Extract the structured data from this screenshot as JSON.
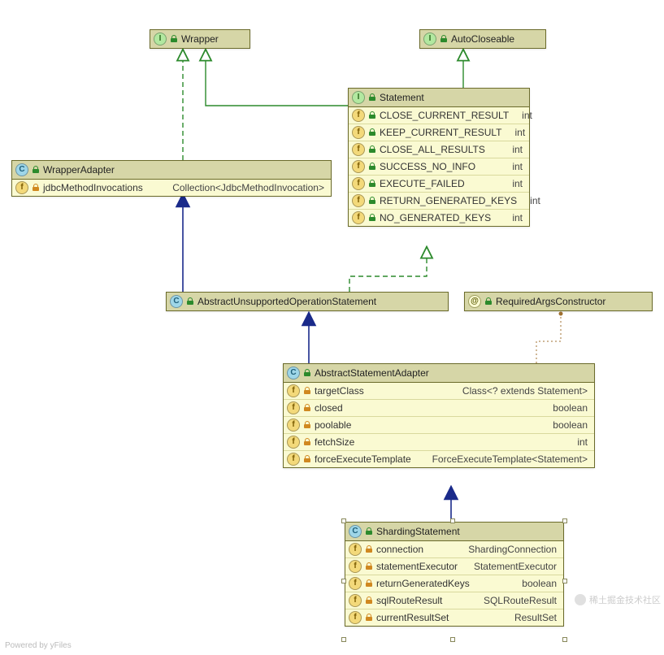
{
  "nodes": {
    "wrapper": {
      "kind": "I",
      "title": "Wrapper"
    },
    "autoCloseable": {
      "kind": "I",
      "title": "AutoCloseable"
    },
    "wrapperAdapter": {
      "kind": "C",
      "title": "WrapperAdapter",
      "rows": [
        {
          "icon": "f",
          "lock": "orange",
          "name": "jdbcMethodInvocations",
          "type": "Collection<JdbcMethodInvocation>"
        }
      ]
    },
    "statement": {
      "kind": "I",
      "title": "Statement",
      "rows": [
        {
          "icon": "f",
          "lock": "green",
          "name": "CLOSE_CURRENT_RESULT",
          "type": "int"
        },
        {
          "icon": "f",
          "lock": "green",
          "name": "KEEP_CURRENT_RESULT",
          "type": "int"
        },
        {
          "icon": "f",
          "lock": "green",
          "name": "CLOSE_ALL_RESULTS",
          "type": "int"
        },
        {
          "icon": "f",
          "lock": "green",
          "name": "SUCCESS_NO_INFO",
          "type": "int"
        },
        {
          "icon": "f",
          "lock": "green",
          "name": "EXECUTE_FAILED",
          "type": "int"
        },
        {
          "icon": "f",
          "lock": "green",
          "name": "RETURN_GENERATED_KEYS",
          "type": "int"
        },
        {
          "icon": "f",
          "lock": "green",
          "name": "NO_GENERATED_KEYS",
          "type": "int"
        }
      ]
    },
    "abstractUnsupported": {
      "kind": "C",
      "title": "AbstractUnsupportedOperationStatement"
    },
    "requiredArgs": {
      "kind": "@",
      "title": "RequiredArgsConstructor"
    },
    "abstractStatementAdapter": {
      "kind": "C",
      "title": "AbstractStatementAdapter",
      "rows": [
        {
          "icon": "f",
          "lock": "orange",
          "name": "targetClass",
          "type": "Class<? extends Statement>"
        },
        {
          "icon": "f",
          "lock": "orange",
          "name": "closed",
          "type": "boolean"
        },
        {
          "icon": "f",
          "lock": "orange",
          "name": "poolable",
          "type": "boolean"
        },
        {
          "icon": "f",
          "lock": "orange",
          "name": "fetchSize",
          "type": "int"
        },
        {
          "icon": "f",
          "lock": "orange",
          "name": "forceExecuteTemplate",
          "type": "ForceExecuteTemplate<Statement>"
        }
      ]
    },
    "shardingStatement": {
      "kind": "C",
      "title": "ShardingStatement",
      "rows": [
        {
          "icon": "f",
          "lock": "orange",
          "name": "connection",
          "type": "ShardingConnection"
        },
        {
          "icon": "f",
          "lock": "orange",
          "name": "statementExecutor",
          "type": "StatementExecutor"
        },
        {
          "icon": "f",
          "lock": "orange",
          "name": "returnGeneratedKeys",
          "type": "boolean"
        },
        {
          "icon": "f",
          "lock": "orange",
          "name": "sqlRouteResult",
          "type": "SQLRouteResult"
        },
        {
          "icon": "f",
          "lock": "orange",
          "name": "currentResultSet",
          "type": "ResultSet"
        }
      ]
    }
  },
  "footer": "Powered by yFiles",
  "watermark": "稀土掘金技术社区"
}
